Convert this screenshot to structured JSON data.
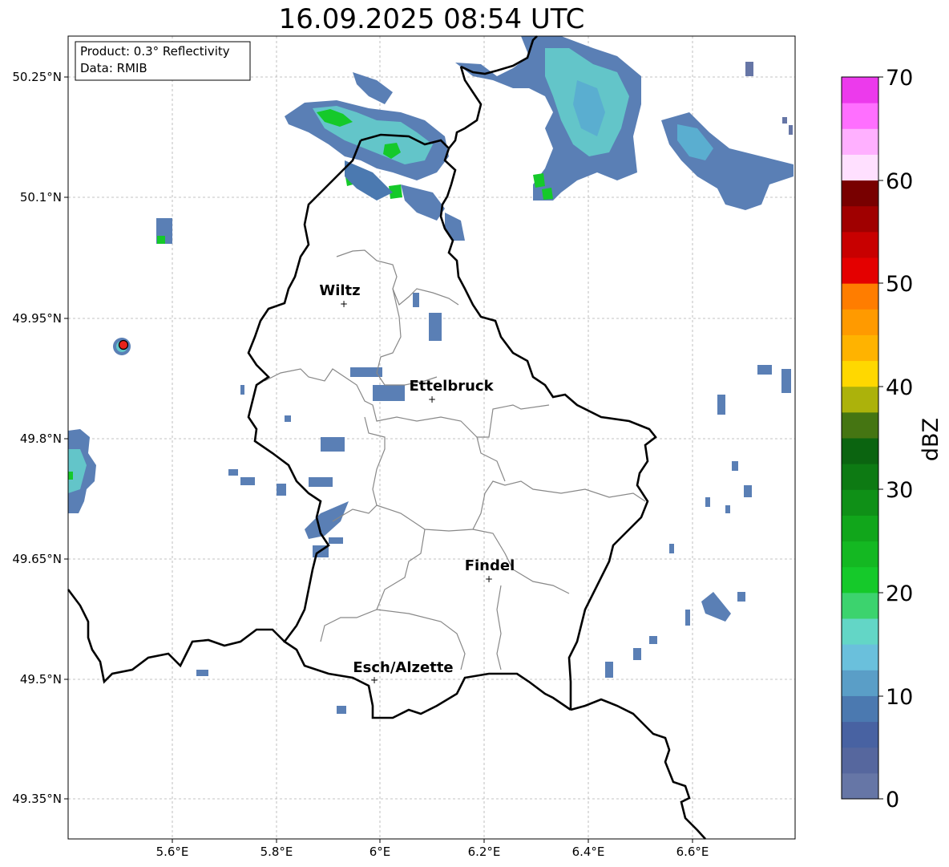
{
  "title": "16.09.2025 08:54 UTC",
  "info_box": {
    "product": "Product: 0.3° Reflectivity",
    "data": "Data: RMIB"
  },
  "axes": {
    "lon_labels": [
      "5.6°E",
      "5.8°E",
      "6°E",
      "6.2°E",
      "6.4°E",
      "6.6°E"
    ],
    "lat_labels": [
      "50.25°N",
      "50.1°N",
      "49.95°N",
      "49.8°N",
      "49.65°N",
      "49.5°N",
      "49.35°N"
    ]
  },
  "colorbar": {
    "label": "dBZ",
    "ticks": [
      "70",
      "60",
      "50",
      "40",
      "30",
      "20",
      "10",
      "0"
    ],
    "colors": [
      "#6676a6",
      "#56679e",
      "#4862a2",
      "#4b79b0",
      "#5a9ec7",
      "#6ac0dc",
      "#63d6c6",
      "#3cd36e",
      "#15c92a",
      "#14b822",
      "#11a61b",
      "#0f9017",
      "#0d7a13",
      "#0b6410",
      "#457512",
      "#acb20b",
      "#ffd800",
      "#ffb300",
      "#ff9a00",
      "#ff7d00",
      "#e40000",
      "#c80000",
      "#a00000",
      "#780000",
      "#ffe0ff",
      "#ffb0ff",
      "#ff6fff",
      "#ec3aec"
    ]
  },
  "towns": [
    {
      "name": "Wiltz"
    },
    {
      "name": "Ettelbruck"
    },
    {
      "name": "Findel"
    },
    {
      "name": "Esch/Alzette"
    }
  ],
  "radar_site_color": "#e8231b"
}
